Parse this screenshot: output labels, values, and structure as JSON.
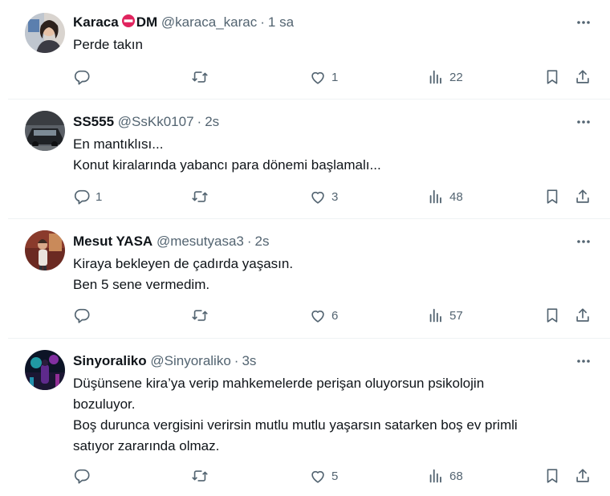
{
  "tweets": [
    {
      "name": "Karaca",
      "name_suffix": "DM",
      "has_badge": true,
      "handle": "@karaca_karac",
      "time": "1 sa",
      "lines": [
        "Perde takın"
      ],
      "replies": "",
      "retweets": "",
      "likes": "1",
      "views": "22"
    },
    {
      "name": "SS555",
      "name_suffix": "",
      "has_badge": false,
      "handle": "@SsKk0107",
      "time": "2s",
      "lines": [
        "En mantıklısı...",
        "Konut kiralarında yabancı para dönemi başlamalı..."
      ],
      "replies": "1",
      "retweets": "",
      "likes": "3",
      "views": "48"
    },
    {
      "name": "Mesut YASA",
      "name_suffix": "",
      "has_badge": false,
      "handle": "@mesutyasa3",
      "time": "2s",
      "lines": [
        "Kiraya bekleyen de çadırda yaşasın.",
        "Ben 5 sene vermedim."
      ],
      "replies": "",
      "retweets": "",
      "likes": "6",
      "views": "57"
    },
    {
      "name": "Sinyoraliko",
      "name_suffix": "",
      "has_badge": false,
      "handle": "@Sinyoraliko",
      "time": "3s",
      "lines": [
        "Düşünsene kira’ya verip mahkemelerde perişan oluyorsun psikolojin",
        "bozuluyor.",
        "Boş durunca vergisini verirsin mutlu mutlu yaşarsın satarken boş ev primli",
        "satıyor zararında olmaz."
      ],
      "replies": "",
      "retweets": "",
      "likes": "5",
      "views": "68"
    }
  ],
  "colors": {
    "text": "#0f1419",
    "muted": "#536471",
    "divider": "#eff3f4",
    "badge": "#e0245e"
  },
  "icons": {
    "reply": "reply-icon",
    "retweet": "retweet-icon",
    "like": "heart-icon",
    "views": "views-icon",
    "bookmark": "bookmark-icon",
    "share": "share-icon",
    "more": "more-icon"
  }
}
